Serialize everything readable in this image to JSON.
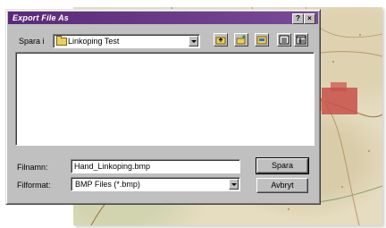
{
  "dialog": {
    "title": "Export File As",
    "help_button": "?",
    "close_button": "×",
    "save_in_label": "Spara i",
    "current_folder": "Linkoping Test",
    "filename_label": "Filnamn:",
    "filename_value": "Hand_Linkoping.bmp",
    "format_label": "Filformat:",
    "format_value": "BMP Files (*.bmp)",
    "save_button": "Spara",
    "cancel_button": "Avbryt"
  },
  "toolbar": {
    "icons": [
      "up-folder-icon",
      "new-folder-icon",
      "desktop-icon",
      "list-view-icon",
      "details-view-icon"
    ]
  },
  "colors": {
    "titlebar": "#5a2a7a",
    "dialog_face": "#c0c0c0",
    "map_background": "#e6dcc0",
    "city_highlight": "#c8504a"
  }
}
